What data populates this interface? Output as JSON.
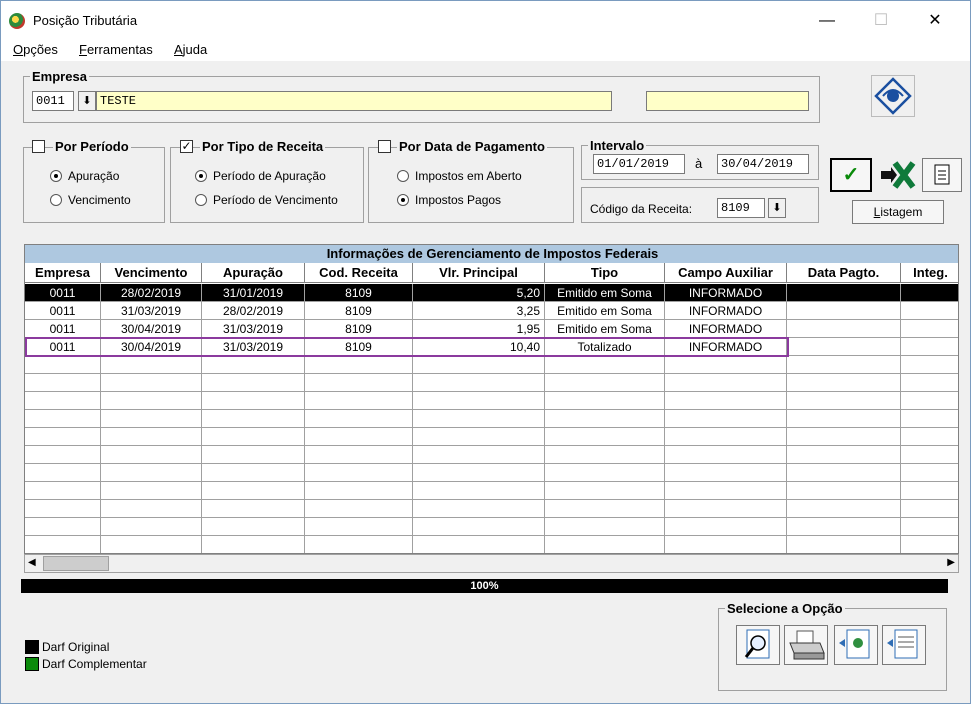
{
  "window": {
    "title": "Posição Tributária",
    "minimize": "—",
    "maximize": "☐",
    "close": "✕"
  },
  "menu": [
    {
      "label": "Opções",
      "accel": "O",
      "rest": "pções"
    },
    {
      "label": "Ferramentas",
      "accel": "F",
      "rest": "erramentas"
    },
    {
      "label": "Ajuda",
      "accel": "A",
      "rest": "juda"
    }
  ],
  "empresa": {
    "legend": "Empresa",
    "code": "0011",
    "name": "TESTE",
    "extra": ""
  },
  "periodo": {
    "label": "Por Período",
    "checked": false,
    "options": [
      "Apuração",
      "Vencimento"
    ],
    "selected": 0
  },
  "tipo_receita": {
    "label": "Por Tipo de Receita",
    "checked": true,
    "options": [
      "Período de Apuração",
      "Período de Vencimento"
    ],
    "selected": 0
  },
  "data_pagamento": {
    "label": "Por Data de Pagamento",
    "checked": false,
    "options": [
      "Impostos em Aberto",
      "Impostos Pagos"
    ],
    "selected": 1
  },
  "intervalo": {
    "legend": "Intervalo",
    "from": "01/01/2019",
    "sep": "à",
    "to": "30/04/2019"
  },
  "codigo_receita": {
    "label": "Código da Receita:",
    "value": "8109"
  },
  "buttons": {
    "listagem": "Listagem",
    "listagem_accel": "L",
    "listagem_rest": "istagem"
  },
  "grid": {
    "title": "Informações de Gerenciamento de Impostos Federais",
    "columns": [
      "Empresa",
      "Vencimento",
      "Apuração",
      "Cod. Receita",
      "Vlr. Principal",
      "Tipo",
      "Campo Auxiliar",
      "Data Pagto.",
      "Integ."
    ],
    "rows": [
      [
        "0011",
        "28/02/2019",
        "31/01/2019",
        "8109",
        "5,20",
        "Emitido em Soma",
        "INFORMADO",
        "",
        ""
      ],
      [
        "0011",
        "31/03/2019",
        "28/02/2019",
        "8109",
        "3,25",
        "Emitido em Soma",
        "INFORMADO",
        "",
        ""
      ],
      [
        "0011",
        "30/04/2019",
        "31/03/2019",
        "8109",
        "1,95",
        "Emitido em Soma",
        "INFORMADO",
        "",
        ""
      ],
      [
        "0011",
        "30/04/2019",
        "31/03/2019",
        "8109",
        "10,40",
        "Totalizado",
        "INFORMADO",
        "",
        ""
      ]
    ],
    "selected_row": 0,
    "highlighted_row": 3
  },
  "progress": {
    "text": "100%",
    "value": 1.0
  },
  "legend_items": [
    {
      "label": "Darf Original",
      "color": "#000000"
    },
    {
      "label": "Darf Complementar",
      "color": "#0a8a0a"
    }
  ],
  "opcoes": {
    "legend": "Selecione a Opção"
  },
  "colors": {
    "grid_title_bg": "#aec8e0",
    "highlight_border": "#8b3a9e",
    "input_yellow": "#ffffc8"
  }
}
